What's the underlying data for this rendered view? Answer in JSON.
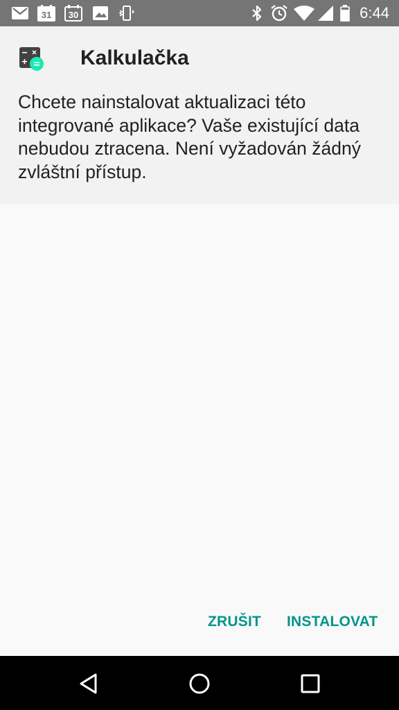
{
  "status_bar": {
    "time": "6:44",
    "calendar_day": "31",
    "calendar_day_outline": "30",
    "notification_icons": [
      "gmail-icon",
      "calendar-icon",
      "calendar-outline-icon",
      "image-icon",
      "vibrate-phone-icon"
    ],
    "system_icons": [
      "bluetooth-icon",
      "alarm-icon",
      "wifi-icon",
      "signal-icon",
      "battery-icon"
    ]
  },
  "dialog": {
    "app_name": "Kalkulačka",
    "app_icon": "calculator-icon",
    "message": "Chcete nainstalovat aktualizaci této integrované aplikace? Vaše existující data nebudou ztracena. Není vyžadován žádný zvláštní přístup.",
    "cancel_label": "ZRUŠIT",
    "install_label": "INSTALOVAT"
  },
  "nav_bar": {
    "back": "back-icon",
    "home": "home-icon",
    "recents": "recents-icon"
  },
  "colors": {
    "accent": "#009688",
    "status_bar": "#757575",
    "header_bg": "#f2f2f2",
    "body_bg": "#f9f9f9",
    "nav_bar": "#000000"
  }
}
